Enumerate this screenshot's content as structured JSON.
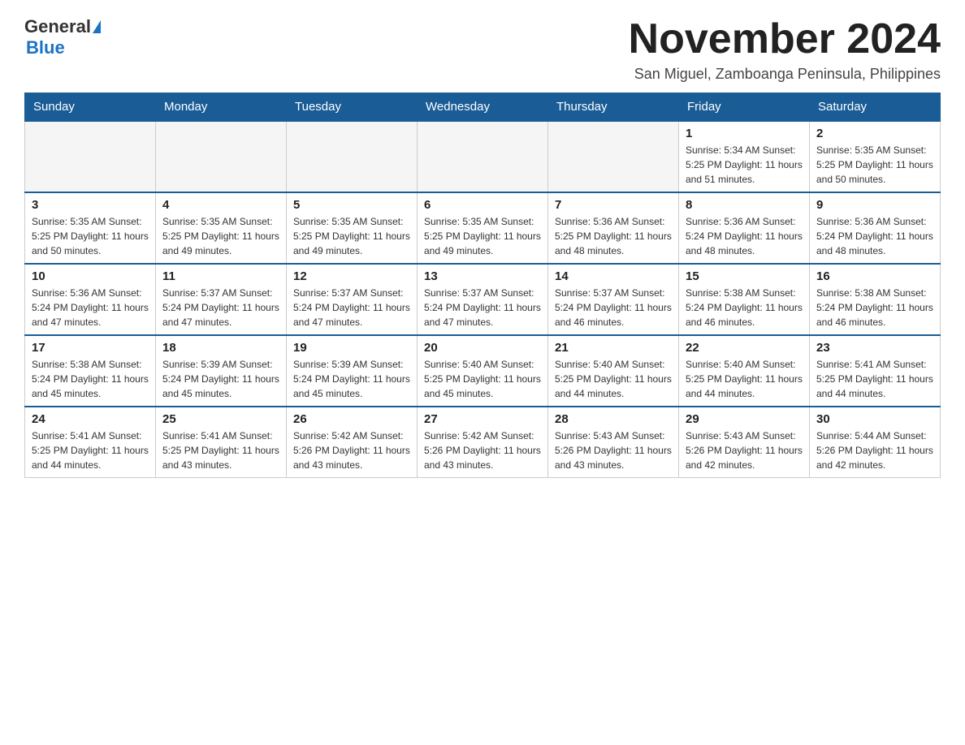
{
  "header": {
    "logo_general": "General",
    "logo_blue": "Blue",
    "month_title": "November 2024",
    "subtitle": "San Miguel, Zamboanga Peninsula, Philippines"
  },
  "days_of_week": [
    "Sunday",
    "Monday",
    "Tuesday",
    "Wednesday",
    "Thursday",
    "Friday",
    "Saturday"
  ],
  "weeks": [
    [
      {
        "day": "",
        "info": ""
      },
      {
        "day": "",
        "info": ""
      },
      {
        "day": "",
        "info": ""
      },
      {
        "day": "",
        "info": ""
      },
      {
        "day": "",
        "info": ""
      },
      {
        "day": "1",
        "info": "Sunrise: 5:34 AM\nSunset: 5:25 PM\nDaylight: 11 hours and 51 minutes."
      },
      {
        "day": "2",
        "info": "Sunrise: 5:35 AM\nSunset: 5:25 PM\nDaylight: 11 hours and 50 minutes."
      }
    ],
    [
      {
        "day": "3",
        "info": "Sunrise: 5:35 AM\nSunset: 5:25 PM\nDaylight: 11 hours and 50 minutes."
      },
      {
        "day": "4",
        "info": "Sunrise: 5:35 AM\nSunset: 5:25 PM\nDaylight: 11 hours and 49 minutes."
      },
      {
        "day": "5",
        "info": "Sunrise: 5:35 AM\nSunset: 5:25 PM\nDaylight: 11 hours and 49 minutes."
      },
      {
        "day": "6",
        "info": "Sunrise: 5:35 AM\nSunset: 5:25 PM\nDaylight: 11 hours and 49 minutes."
      },
      {
        "day": "7",
        "info": "Sunrise: 5:36 AM\nSunset: 5:25 PM\nDaylight: 11 hours and 48 minutes."
      },
      {
        "day": "8",
        "info": "Sunrise: 5:36 AM\nSunset: 5:24 PM\nDaylight: 11 hours and 48 minutes."
      },
      {
        "day": "9",
        "info": "Sunrise: 5:36 AM\nSunset: 5:24 PM\nDaylight: 11 hours and 48 minutes."
      }
    ],
    [
      {
        "day": "10",
        "info": "Sunrise: 5:36 AM\nSunset: 5:24 PM\nDaylight: 11 hours and 47 minutes."
      },
      {
        "day": "11",
        "info": "Sunrise: 5:37 AM\nSunset: 5:24 PM\nDaylight: 11 hours and 47 minutes."
      },
      {
        "day": "12",
        "info": "Sunrise: 5:37 AM\nSunset: 5:24 PM\nDaylight: 11 hours and 47 minutes."
      },
      {
        "day": "13",
        "info": "Sunrise: 5:37 AM\nSunset: 5:24 PM\nDaylight: 11 hours and 47 minutes."
      },
      {
        "day": "14",
        "info": "Sunrise: 5:37 AM\nSunset: 5:24 PM\nDaylight: 11 hours and 46 minutes."
      },
      {
        "day": "15",
        "info": "Sunrise: 5:38 AM\nSunset: 5:24 PM\nDaylight: 11 hours and 46 minutes."
      },
      {
        "day": "16",
        "info": "Sunrise: 5:38 AM\nSunset: 5:24 PM\nDaylight: 11 hours and 46 minutes."
      }
    ],
    [
      {
        "day": "17",
        "info": "Sunrise: 5:38 AM\nSunset: 5:24 PM\nDaylight: 11 hours and 45 minutes."
      },
      {
        "day": "18",
        "info": "Sunrise: 5:39 AM\nSunset: 5:24 PM\nDaylight: 11 hours and 45 minutes."
      },
      {
        "day": "19",
        "info": "Sunrise: 5:39 AM\nSunset: 5:24 PM\nDaylight: 11 hours and 45 minutes."
      },
      {
        "day": "20",
        "info": "Sunrise: 5:40 AM\nSunset: 5:25 PM\nDaylight: 11 hours and 45 minutes."
      },
      {
        "day": "21",
        "info": "Sunrise: 5:40 AM\nSunset: 5:25 PM\nDaylight: 11 hours and 44 minutes."
      },
      {
        "day": "22",
        "info": "Sunrise: 5:40 AM\nSunset: 5:25 PM\nDaylight: 11 hours and 44 minutes."
      },
      {
        "day": "23",
        "info": "Sunrise: 5:41 AM\nSunset: 5:25 PM\nDaylight: 11 hours and 44 minutes."
      }
    ],
    [
      {
        "day": "24",
        "info": "Sunrise: 5:41 AM\nSunset: 5:25 PM\nDaylight: 11 hours and 44 minutes."
      },
      {
        "day": "25",
        "info": "Sunrise: 5:41 AM\nSunset: 5:25 PM\nDaylight: 11 hours and 43 minutes."
      },
      {
        "day": "26",
        "info": "Sunrise: 5:42 AM\nSunset: 5:26 PM\nDaylight: 11 hours and 43 minutes."
      },
      {
        "day": "27",
        "info": "Sunrise: 5:42 AM\nSunset: 5:26 PM\nDaylight: 11 hours and 43 minutes."
      },
      {
        "day": "28",
        "info": "Sunrise: 5:43 AM\nSunset: 5:26 PM\nDaylight: 11 hours and 43 minutes."
      },
      {
        "day": "29",
        "info": "Sunrise: 5:43 AM\nSunset: 5:26 PM\nDaylight: 11 hours and 42 minutes."
      },
      {
        "day": "30",
        "info": "Sunrise: 5:44 AM\nSunset: 5:26 PM\nDaylight: 11 hours and 42 minutes."
      }
    ]
  ]
}
